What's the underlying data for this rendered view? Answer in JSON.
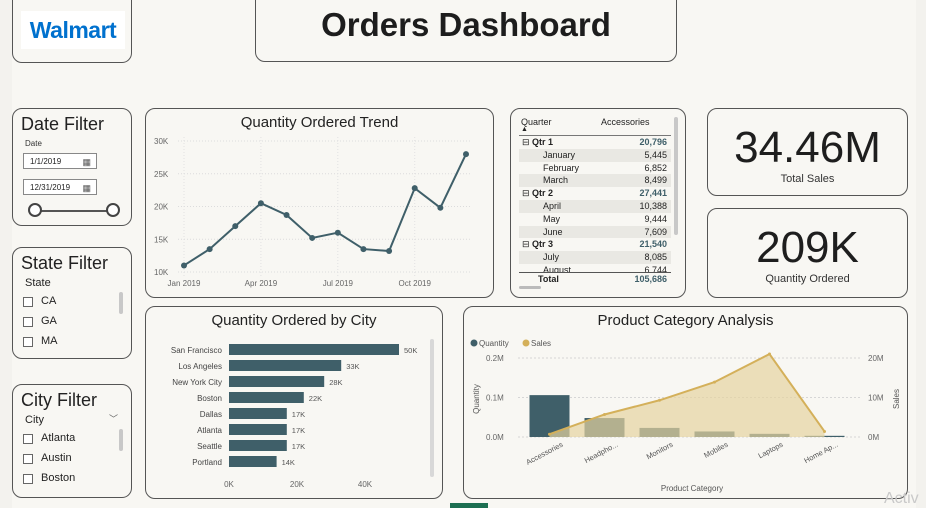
{
  "logo": {
    "text": "Walmart"
  },
  "header": {
    "title": "Orders Dashboard"
  },
  "date_filter": {
    "title": "Date Filter",
    "label": "Date",
    "start": "1/1/2019",
    "end": "12/31/2019"
  },
  "state_filter": {
    "title": "State Filter",
    "label": "State",
    "items": [
      "CA",
      "GA",
      "MA"
    ]
  },
  "city_filter": {
    "title": "City Filter",
    "label": "City",
    "items": [
      "Atlanta",
      "Austin",
      "Boston"
    ]
  },
  "trend": {
    "title": "Quantity Ordered Trend"
  },
  "matrix": {
    "headers": [
      "Quarter",
      "Accessories"
    ],
    "rows": [
      {
        "label": "Qtr 1",
        "value": "20,796",
        "level": 0
      },
      {
        "label": "January",
        "value": "5,445",
        "level": 1
      },
      {
        "label": "February",
        "value": "6,852",
        "level": 1
      },
      {
        "label": "March",
        "value": "8,499",
        "level": 1
      },
      {
        "label": "Qtr 2",
        "value": "27,441",
        "level": 0
      },
      {
        "label": "April",
        "value": "10,388",
        "level": 1
      },
      {
        "label": "May",
        "value": "9,444",
        "level": 1
      },
      {
        "label": "June",
        "value": "7,609",
        "level": 1
      },
      {
        "label": "Qtr 3",
        "value": "21,540",
        "level": 0
      },
      {
        "label": "July",
        "value": "8,085",
        "level": 1
      },
      {
        "label": "August",
        "value": "6,744",
        "level": 1
      }
    ],
    "total_label": "Total",
    "total_value": "105,686",
    "expand_glyph": "⊟"
  },
  "kpis": [
    {
      "value": "34.46M",
      "label": "Total Sales"
    },
    {
      "value": "209K",
      "label": "Quantity Ordered"
    }
  ],
  "colors": {
    "primary": "#3f5f69",
    "sales": "#d4b05a",
    "sales_fill": "#e6d3a0"
  },
  "chart_data": [
    {
      "type": "line",
      "title": "Quantity Ordered Trend",
      "x_tick_labels": [
        "Jan 2019",
        "Apr 2019",
        "Jul 2019",
        "Oct 2019"
      ],
      "y_tick_labels": [
        "10K",
        "15K",
        "20K",
        "25K",
        "30K"
      ],
      "ylim": [
        10000,
        30000
      ],
      "x": [
        1,
        2,
        3,
        4,
        5,
        6,
        7,
        8,
        9,
        10,
        11,
        12
      ],
      "values": [
        11000,
        13500,
        17000,
        20500,
        18700,
        15200,
        16000,
        13500,
        13200,
        22800,
        19800,
        28000
      ]
    },
    {
      "type": "bar",
      "orientation": "horizontal",
      "title": "Quantity Ordered by City",
      "categories": [
        "San Francisco",
        "Los Angeles",
        "New York City",
        "Boston",
        "Dallas",
        "Atlanta",
        "Seattle",
        "Portland"
      ],
      "values": [
        50000,
        33000,
        28000,
        22000,
        17000,
        17000,
        17000,
        14000
      ],
      "data_labels": [
        "50K",
        "33K",
        "28K",
        "22K",
        "17K",
        "17K",
        "17K",
        "14K"
      ],
      "x_tick_labels": [
        "0K",
        "20K",
        "40K"
      ],
      "xlim": [
        0,
        60000
      ]
    },
    {
      "type": "bar",
      "title": "Product Category Analysis",
      "xlabel": "Product Category",
      "categories": [
        "Accessories",
        "Headpho...",
        "Monitors",
        "Mobiles",
        "Laptops",
        "Home Ap..."
      ],
      "series": [
        {
          "name": "Quantity",
          "type": "bar",
          "axis": "left",
          "values": [
            106000,
            48000,
            23000,
            14000,
            8000,
            3000
          ]
        },
        {
          "name": "Sales",
          "type": "area",
          "axis": "right",
          "values": [
            700000,
            5700000,
            9300000,
            13900000,
            21000000,
            1400000
          ]
        }
      ],
      "ylabel_left": "Quantity",
      "ylabel_right": "Sales",
      "y_left_ticks": [
        "0.0M",
        "0.1M",
        "0.2M"
      ],
      "y_right_ticks": [
        "0M",
        "10M",
        "20M"
      ],
      "ylim_left": [
        0,
        200000
      ],
      "ylim_right": [
        0,
        20000000
      ]
    }
  ],
  "watermark": "Activ"
}
